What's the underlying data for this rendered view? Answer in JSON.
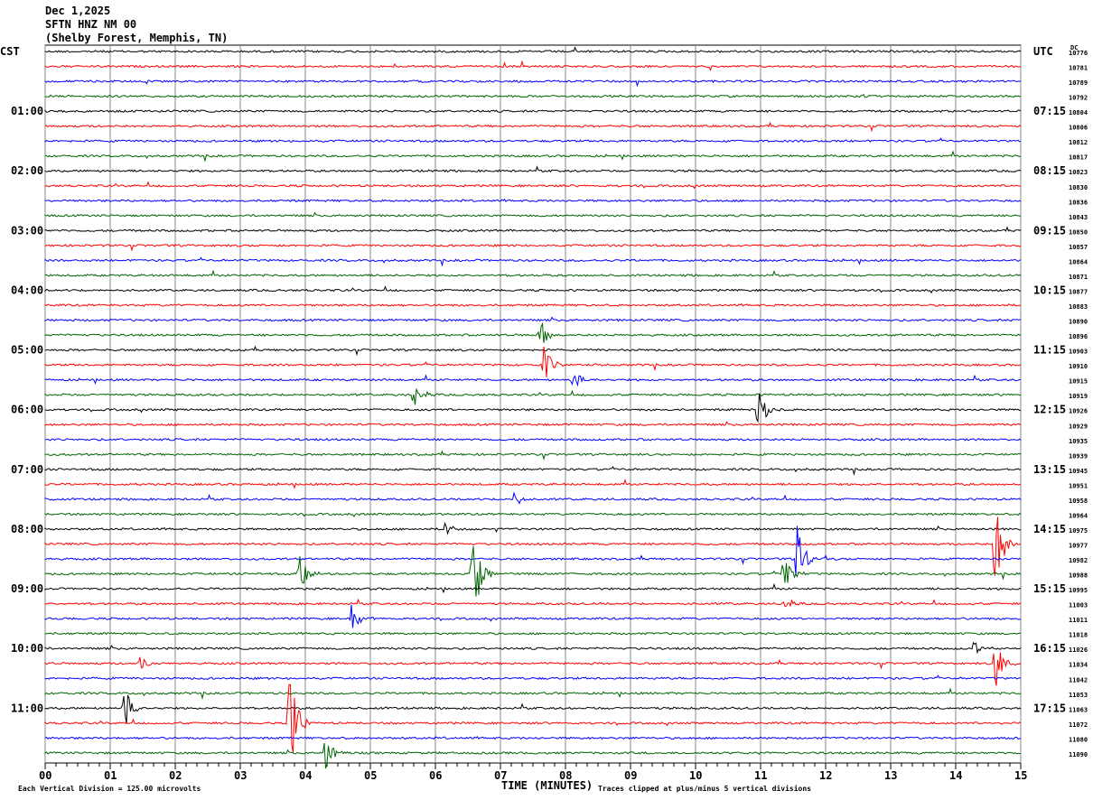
{
  "header": {
    "date": "Dec 1,2025",
    "station": "SFTN HNZ NM 00",
    "location": "(Shelby Forest, Memphis, TN)"
  },
  "chart_data": {
    "type": "line",
    "subtype": "helicorder",
    "xlabel": "TIME (MINUTES)",
    "x_ticks": [
      "00",
      "01",
      "02",
      "03",
      "04",
      "05",
      "06",
      "07",
      "08",
      "09",
      "10",
      "11",
      "12",
      "13",
      "14",
      "15"
    ],
    "xlim": [
      0,
      15
    ],
    "grid": true,
    "left_axis_label": "CST",
    "right_axis_label": "UTC",
    "dc_label": "DC",
    "left_hour_labels": [
      "01:00",
      "02:00",
      "03:00",
      "04:00",
      "05:00",
      "06:00",
      "07:00",
      "08:00",
      "09:00",
      "10:00",
      "11:00"
    ],
    "right_hour_labels": [
      "07:15",
      "08:15",
      "09:15",
      "10:15",
      "11:15",
      "12:15",
      "13:15",
      "14:15",
      "15:15",
      "16:15",
      "17:15"
    ],
    "trace_colors": [
      "#000000",
      "#ff0000",
      "#0000ff",
      "#006400"
    ],
    "dc_values": [
      "10776",
      "10781",
      "10789",
      "10792",
      "10804",
      "10806",
      "10812",
      "10817",
      "10823",
      "10830",
      "10836",
      "10843",
      "10850",
      "10857",
      "10864",
      "10871",
      "10877",
      "10883",
      "10890",
      "10896",
      "10903",
      "10910",
      "10915",
      "10919",
      "10926",
      "10929",
      "10935",
      "10939",
      "10945",
      "10951",
      "10958",
      "10964",
      "10975",
      "10977",
      "10982",
      "10988",
      "10995",
      "11003",
      "11011",
      "11018",
      "11026",
      "11034",
      "11042",
      "11053",
      "11063",
      "11072",
      "11080",
      "11090"
    ],
    "events": [
      {
        "trace": 19,
        "minute": 7.6,
        "amplitude": 1.2
      },
      {
        "trace": 21,
        "minute": 7.65,
        "amplitude": 1.5
      },
      {
        "trace": 22,
        "minute": 8.1,
        "amplitude": 1.0
      },
      {
        "trace": 23,
        "minute": 5.65,
        "amplitude": 1.2
      },
      {
        "trace": 24,
        "minute": 10.95,
        "amplitude": 2.0
      },
      {
        "trace": 30,
        "minute": 7.2,
        "amplitude": 0.6
      },
      {
        "trace": 32,
        "minute": 6.15,
        "amplitude": 0.6
      },
      {
        "trace": 33,
        "minute": 14.6,
        "amplitude": 4.0
      },
      {
        "trace": 34,
        "minute": 11.55,
        "amplitude": 2.5
      },
      {
        "trace": 35,
        "minute": 6.55,
        "amplitude": 4.5
      },
      {
        "trace": 35,
        "minute": 11.35,
        "amplitude": 1.5
      },
      {
        "trace": 35,
        "minute": 3.9,
        "amplitude": 2.0
      },
      {
        "trace": 37,
        "minute": 11.35,
        "amplitude": 0.6
      },
      {
        "trace": 38,
        "minute": 4.7,
        "amplitude": 1.2
      },
      {
        "trace": 40,
        "minute": 14.25,
        "amplitude": 0.7
      },
      {
        "trace": 41,
        "minute": 14.6,
        "amplitude": 2.0
      },
      {
        "trace": 41,
        "minute": 1.45,
        "amplitude": 0.7
      },
      {
        "trace": 44,
        "minute": 1.2,
        "amplitude": 2.0
      },
      {
        "trace": 45,
        "minute": 3.75,
        "amplitude": 5.0
      },
      {
        "trace": 47,
        "minute": 4.3,
        "amplitude": 1.3
      }
    ]
  },
  "footer": {
    "scale_note": "Each Vertical Division =  125.00 microvolts",
    "clip_note": "Traces clipped at plus/minus 5 vertical divisions"
  }
}
